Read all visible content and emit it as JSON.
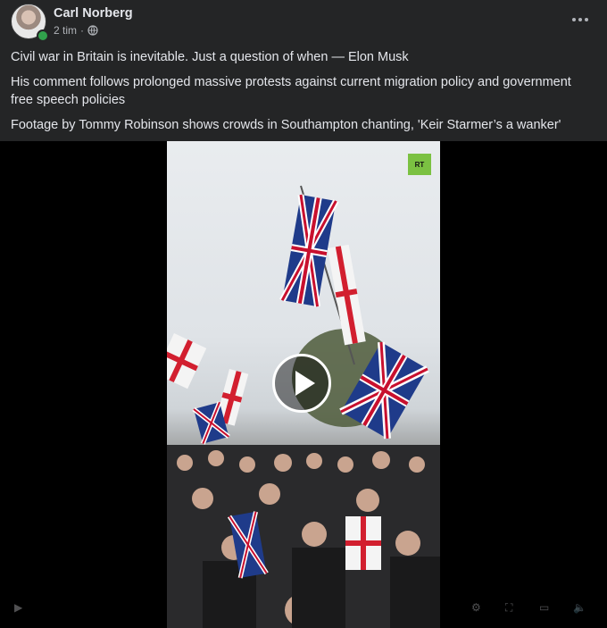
{
  "post": {
    "author": "Carl Norberg",
    "time": "2 tim",
    "separator": "·",
    "privacy_icon": "globe-icon",
    "text": [
      "Civil war in Britain is inevitable. Just a question of when — Elon Musk",
      "His comment follows prolonged massive protests against current migration policy and government free speech policies",
      "Footage by Tommy Robinson shows crowds in Southampton chanting, 'Keir Starmer’s a wanker'"
    ]
  },
  "video": {
    "watermark": "RT",
    "play_icon": "play-icon"
  },
  "colors": {
    "background": "#242526",
    "online": "#31a24c",
    "rt_green": "#7bc142"
  }
}
